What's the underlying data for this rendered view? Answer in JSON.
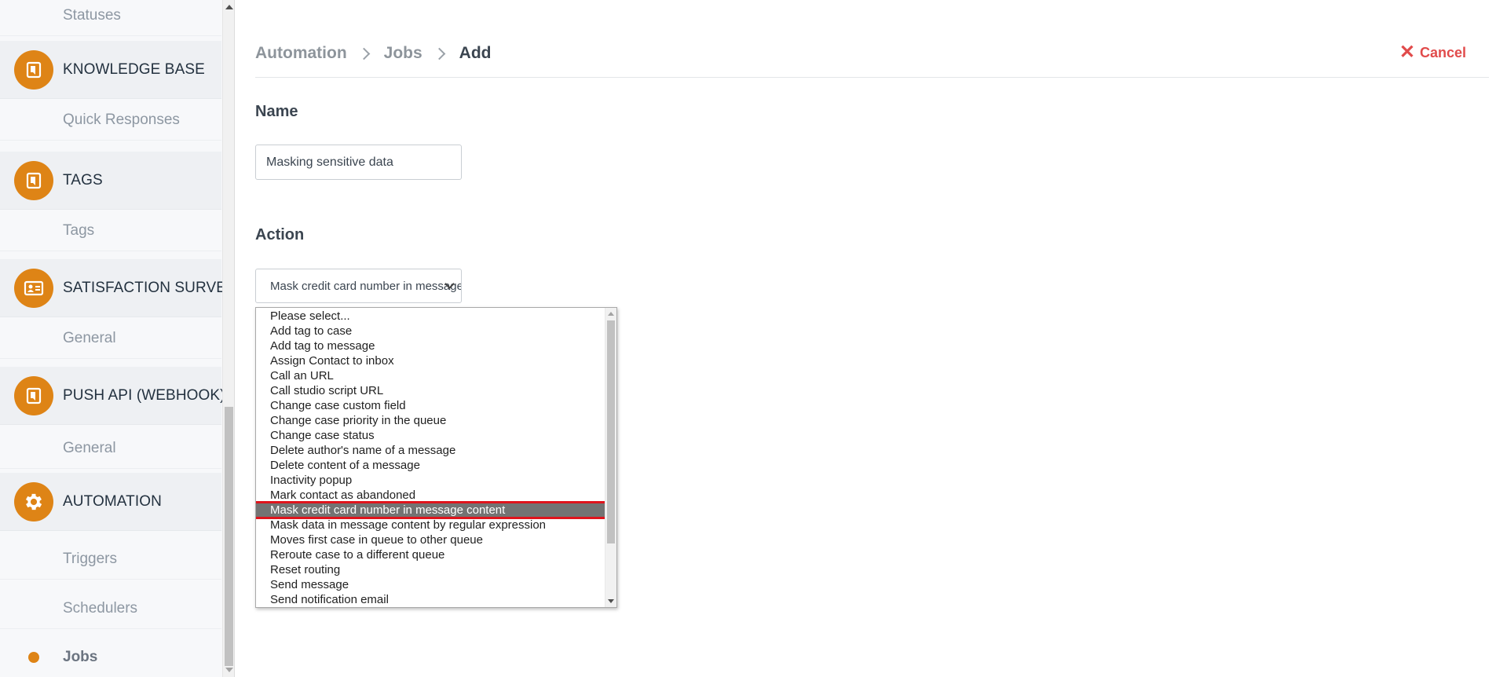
{
  "sidebar": {
    "sections": [
      {
        "sub_label": "Statuses"
      },
      {
        "title": "KNOWLEDGE BASE",
        "icon": "document-icon",
        "items": [
          "Quick Responses"
        ]
      },
      {
        "title": "TAGS",
        "icon": "document-icon",
        "items": [
          "Tags"
        ]
      },
      {
        "title": "SATISFACTION SURVEYS",
        "icon": "id-card-icon",
        "items": [
          "General"
        ]
      },
      {
        "title": "PUSH API (WEBHOOK)",
        "icon": "document-icon",
        "items": [
          "General"
        ]
      },
      {
        "title": "AUTOMATION",
        "icon": "gear-icon",
        "items": [
          "Triggers",
          "Schedulers",
          "Jobs"
        ],
        "active_item": "Jobs"
      }
    ],
    "accent_color": "#de8416"
  },
  "breadcrumb": [
    "Automation",
    "Jobs",
    "Add"
  ],
  "cancel_label": "Cancel",
  "form": {
    "name_label": "Name",
    "name_value": "Masking sensitive data",
    "action_label": "Action",
    "action_selected": "Mask credit card number in message content"
  },
  "action_options": [
    "Please select...",
    "Add tag to case",
    "Add tag to message",
    "Assign Contact to inbox",
    "Call an URL",
    "Call studio script URL",
    "Change case custom field",
    "Change case priority in the queue",
    "Change case status",
    "Delete author's name of a message",
    "Delete content of a message",
    "Inactivity popup",
    "Mark contact as abandoned",
    "Mask credit card number in message content",
    "Mask data in message content by regular expression",
    "Moves first case in queue to other queue",
    "Reroute case to a different queue",
    "Reset routing",
    "Send message",
    "Send notification email"
  ],
  "colors": {
    "cancel": "#e14b4b",
    "selection_highlight": "#737373",
    "annotation_box": "#e0141c"
  }
}
